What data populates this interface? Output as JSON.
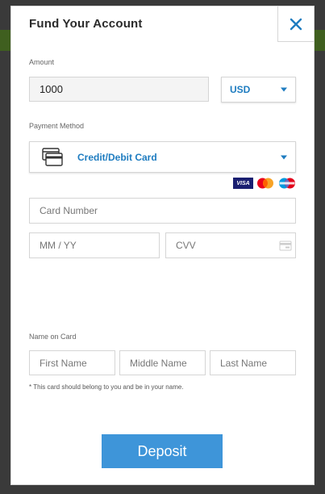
{
  "modal": {
    "title": "Fund Your Account",
    "close_icon": "close-icon"
  },
  "amount": {
    "label": "Amount",
    "value": "1000",
    "currency": "USD"
  },
  "payment": {
    "label": "Payment Method",
    "method": "Credit/Debit Card",
    "method_icon": "credit-card-icon",
    "brands": [
      "VISA",
      "mastercard",
      "Maestro"
    ]
  },
  "card": {
    "number_placeholder": "Card Number",
    "expiry_placeholder": "MM / YY",
    "cvv_placeholder": "CVV",
    "cvv_icon": "card-back-icon"
  },
  "name": {
    "label": "Name on Card",
    "first_placeholder": "First Name",
    "middle_placeholder": "Middle Name",
    "last_placeholder": "Last Name",
    "note": "* This card should belong to you and be in your name."
  },
  "deposit": {
    "label": "Deposit"
  },
  "colors": {
    "accent": "#1e7cc0",
    "button": "#3e95d9",
    "visa": "#1a1f71"
  }
}
